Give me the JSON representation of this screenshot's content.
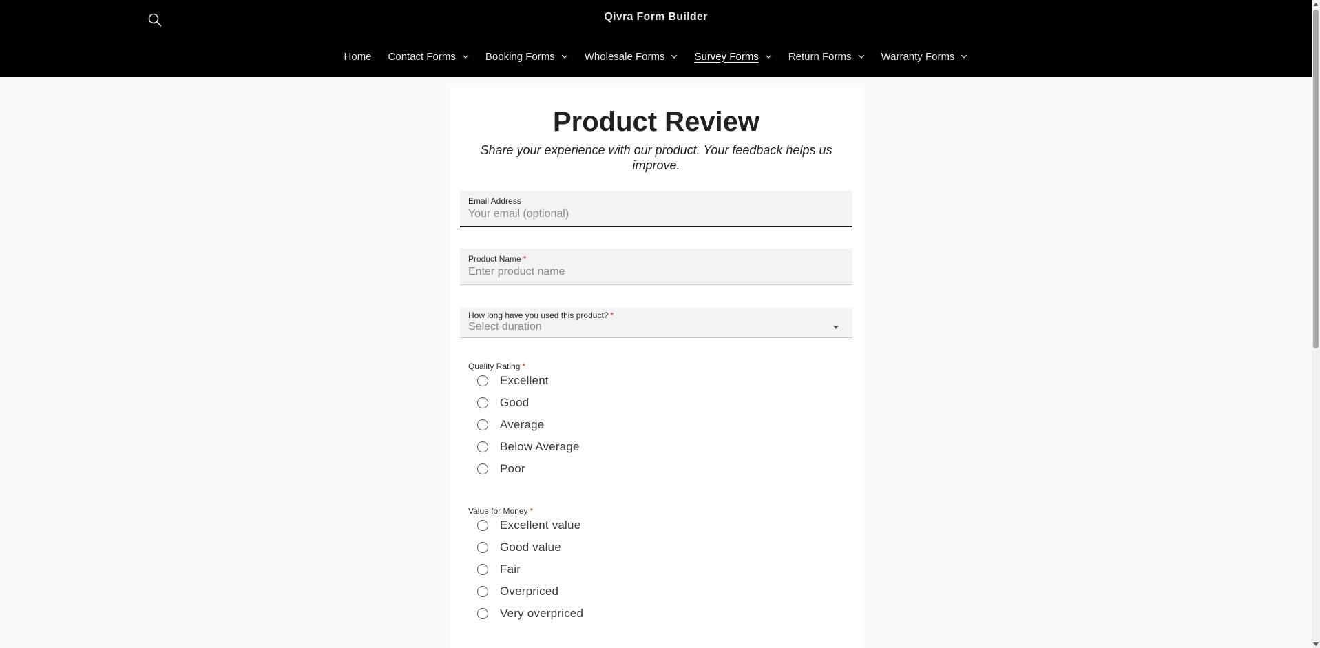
{
  "header": {
    "brand": "Qivra Form Builder",
    "nav": [
      {
        "label": "Home",
        "has_dropdown": false
      },
      {
        "label": "Contact Forms",
        "has_dropdown": true
      },
      {
        "label": "Booking Forms",
        "has_dropdown": true
      },
      {
        "label": "Wholesale Forms",
        "has_dropdown": true
      },
      {
        "label": "Survey Forms",
        "has_dropdown": true,
        "active": true
      },
      {
        "label": "Return Forms",
        "has_dropdown": true
      },
      {
        "label": "Warranty Forms",
        "has_dropdown": true
      }
    ]
  },
  "form": {
    "title": "Product Review",
    "subtitle": "Share your experience with our product. Your feedback helps us improve.",
    "required_mark": "*",
    "email": {
      "label": "Email Address",
      "placeholder": "Your email (optional)",
      "value": ""
    },
    "product_name": {
      "label": "Product Name",
      "placeholder": "Enter product name",
      "value": ""
    },
    "duration": {
      "label": "How long have you used this product?",
      "selected": "Select duration"
    },
    "quality": {
      "label": "Quality Rating",
      "options": [
        "Excellent",
        "Good",
        "Average",
        "Below Average",
        "Poor"
      ]
    },
    "value_for_money": {
      "label": "Value for Money",
      "options": [
        "Excellent value",
        "Good value",
        "Fair",
        "Overpriced",
        "Very overpriced"
      ]
    }
  },
  "colors": {
    "header_bg": "#000000",
    "page_bg": "#fafaf8",
    "field_bg": "#f3f3f3",
    "required": "#d8342a"
  },
  "icons": {
    "search": "search-icon",
    "dropdown": "chevron-down-icon",
    "select_caret": "caret-down-icon"
  }
}
